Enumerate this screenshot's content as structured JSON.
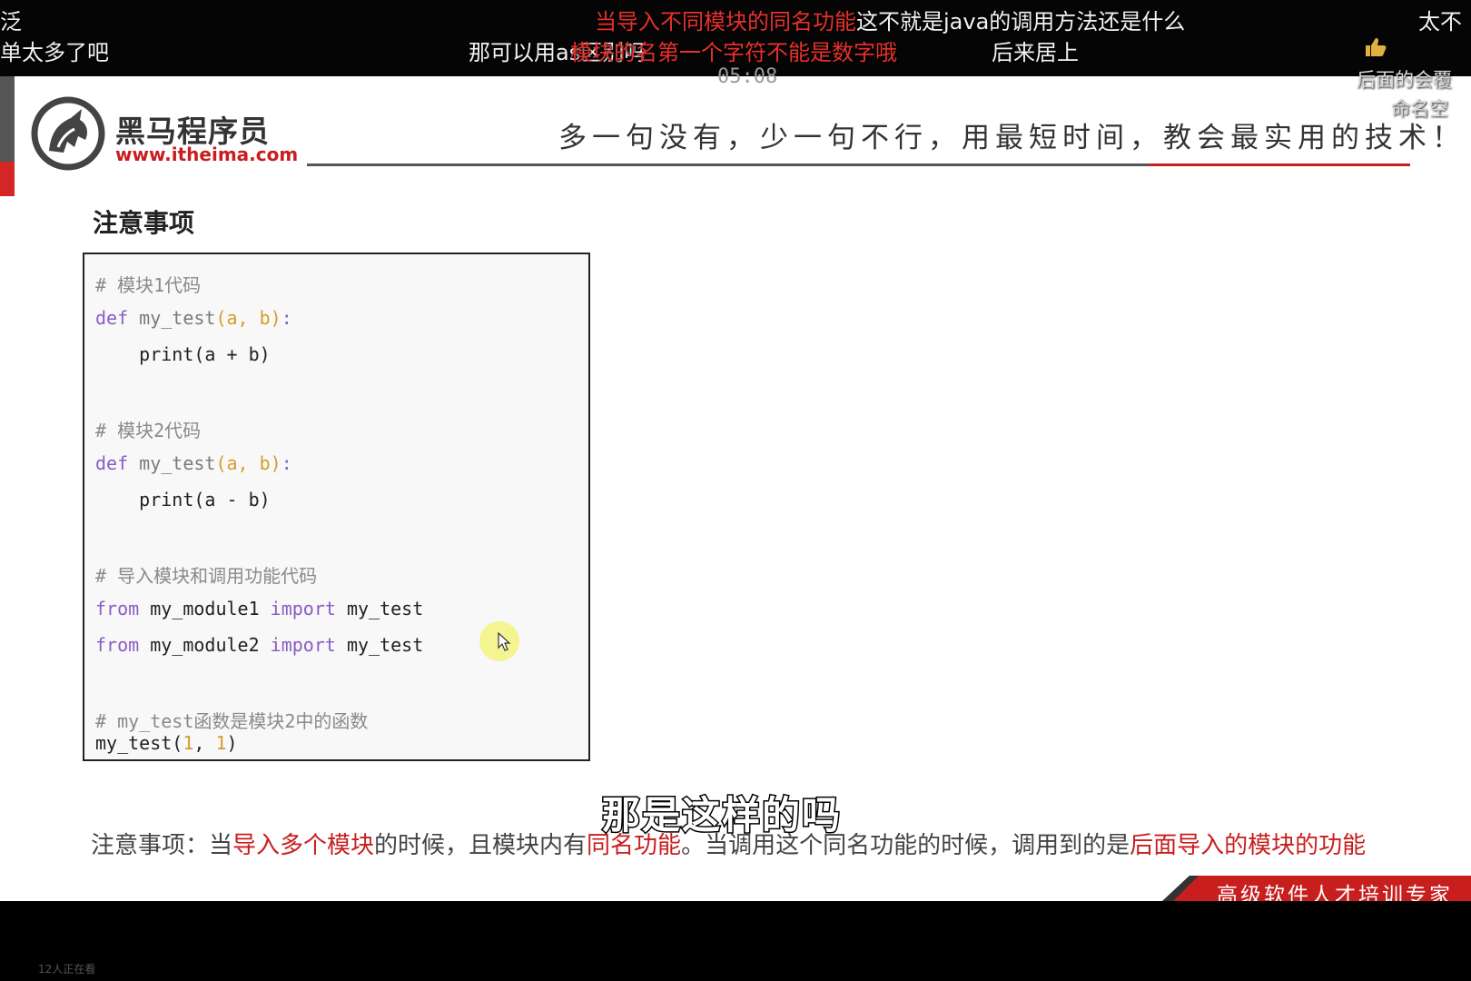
{
  "danmaku": [
    {
      "text": "当导入不同模块的同名功能",
      "color": "red"
    },
    {
      "text": "这不就是java的调用方法还是什么",
      "color": "white"
    },
    {
      "text": "太不",
      "color": "white"
    },
    {
      "text": "单太多了吧",
      "color": "white"
    },
    {
      "text": "那可以用as区别吗",
      "color": "white"
    },
    {
      "text": "模块的名第一个字符不能是数字哦",
      "color": "red"
    },
    {
      "text": "后来居上",
      "color": "white"
    },
    {
      "text": "后面的会覆",
      "color": "white"
    },
    {
      "text": "命名空",
      "color": "white"
    },
    {
      "text": "泛",
      "color": "white"
    }
  ],
  "player": {
    "timestamp": "05:08",
    "viewers": "12人正在看",
    "subtitle": "那是这样的吗"
  },
  "slide": {
    "brand_name": "黑马程序员",
    "brand_url": "www.itheima.com",
    "slogan": "多一句没有，少一句不行，用最短时间，教会最实用的技术！",
    "section_title": "注意事项",
    "code": {
      "comment1": "# 模块1代码",
      "def1_kw": "def",
      "def1_name": " my_test",
      "def1_params": "(a, b)",
      "def1_colon": ":",
      "body1": "    print(a + b)",
      "comment2": "# 模块2代码",
      "def2_kw": "def",
      "def2_name": " my_test",
      "def2_params": "(a, b)",
      "def2_colon": ":",
      "body2": "    print(a - b)",
      "comment3": "# 导入模块和调用功能代码",
      "from1_kw": "from",
      "from1_mod": " my_module1 ",
      "import1_kw": "import",
      "import1_name": " my_test",
      "from2_kw": "from",
      "from2_mod": " my_module2 ",
      "import2_kw": "import",
      "import2_name": " my_test",
      "comment4": "# my_test函数是模块2中的函数",
      "call_name": "my_test(",
      "call_arg1": "1",
      "call_sep": ", ",
      "call_arg2": "1",
      "call_close": ")"
    },
    "note": {
      "p1": "注意事项：当",
      "h1": "导入多个模块",
      "p2": "的时候，且模块内有",
      "h2": "同名功能",
      "p3": "。当调用这个同名功能的时候，调用到的是",
      "h3": "后面导入的模块的功能"
    },
    "footer": "高级软件人才培训专家"
  },
  "colors": {
    "brand_red": "#c81e1e",
    "danmaku_red": "#e8302c",
    "keyword_purple": "#8a5cc4",
    "number_orange": "#d99a2b"
  }
}
